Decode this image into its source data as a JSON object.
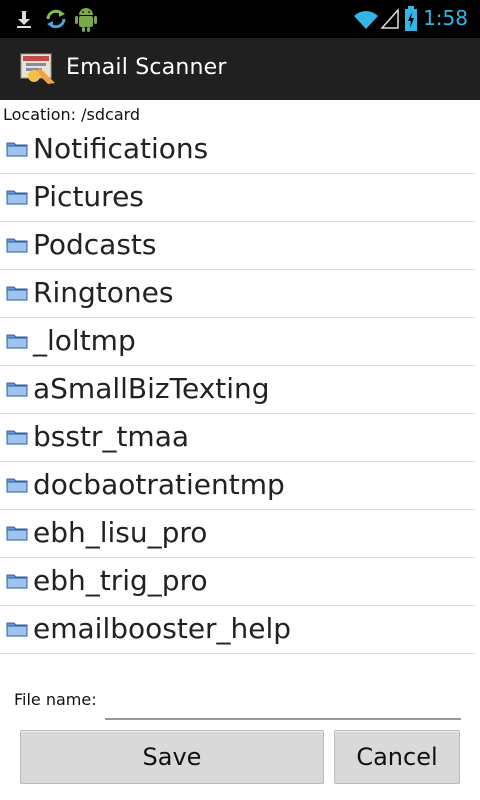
{
  "status_bar": {
    "time": "1:58",
    "left_icons": [
      "download-icon",
      "sync-icon",
      "android-icon"
    ],
    "right_icons": [
      "wifi-icon",
      "signal-icon",
      "battery-charging-icon"
    ]
  },
  "app_bar": {
    "title": "Email Scanner",
    "icon": "app-icon"
  },
  "location": "Location: /sdcard",
  "items": [
    {
      "label": "Notifications"
    },
    {
      "label": "Pictures"
    },
    {
      "label": "Podcasts"
    },
    {
      "label": "Ringtones"
    },
    {
      "label": "_loltmp"
    },
    {
      "label": "aSmallBizTexting"
    },
    {
      "label": "bsstr_tmaa"
    },
    {
      "label": "docbaotratientmp"
    },
    {
      "label": "ebh_lisu_pro"
    },
    {
      "label": "ebh_trig_pro"
    },
    {
      "label": "emailbooster_help"
    }
  ],
  "file_name": {
    "label": "File name:",
    "value": "",
    "placeholder": ""
  },
  "buttons": {
    "save": "Save",
    "cancel": "Cancel"
  },
  "colors": {
    "accent": "#33b5e5",
    "folder": "#6a9ad8"
  }
}
